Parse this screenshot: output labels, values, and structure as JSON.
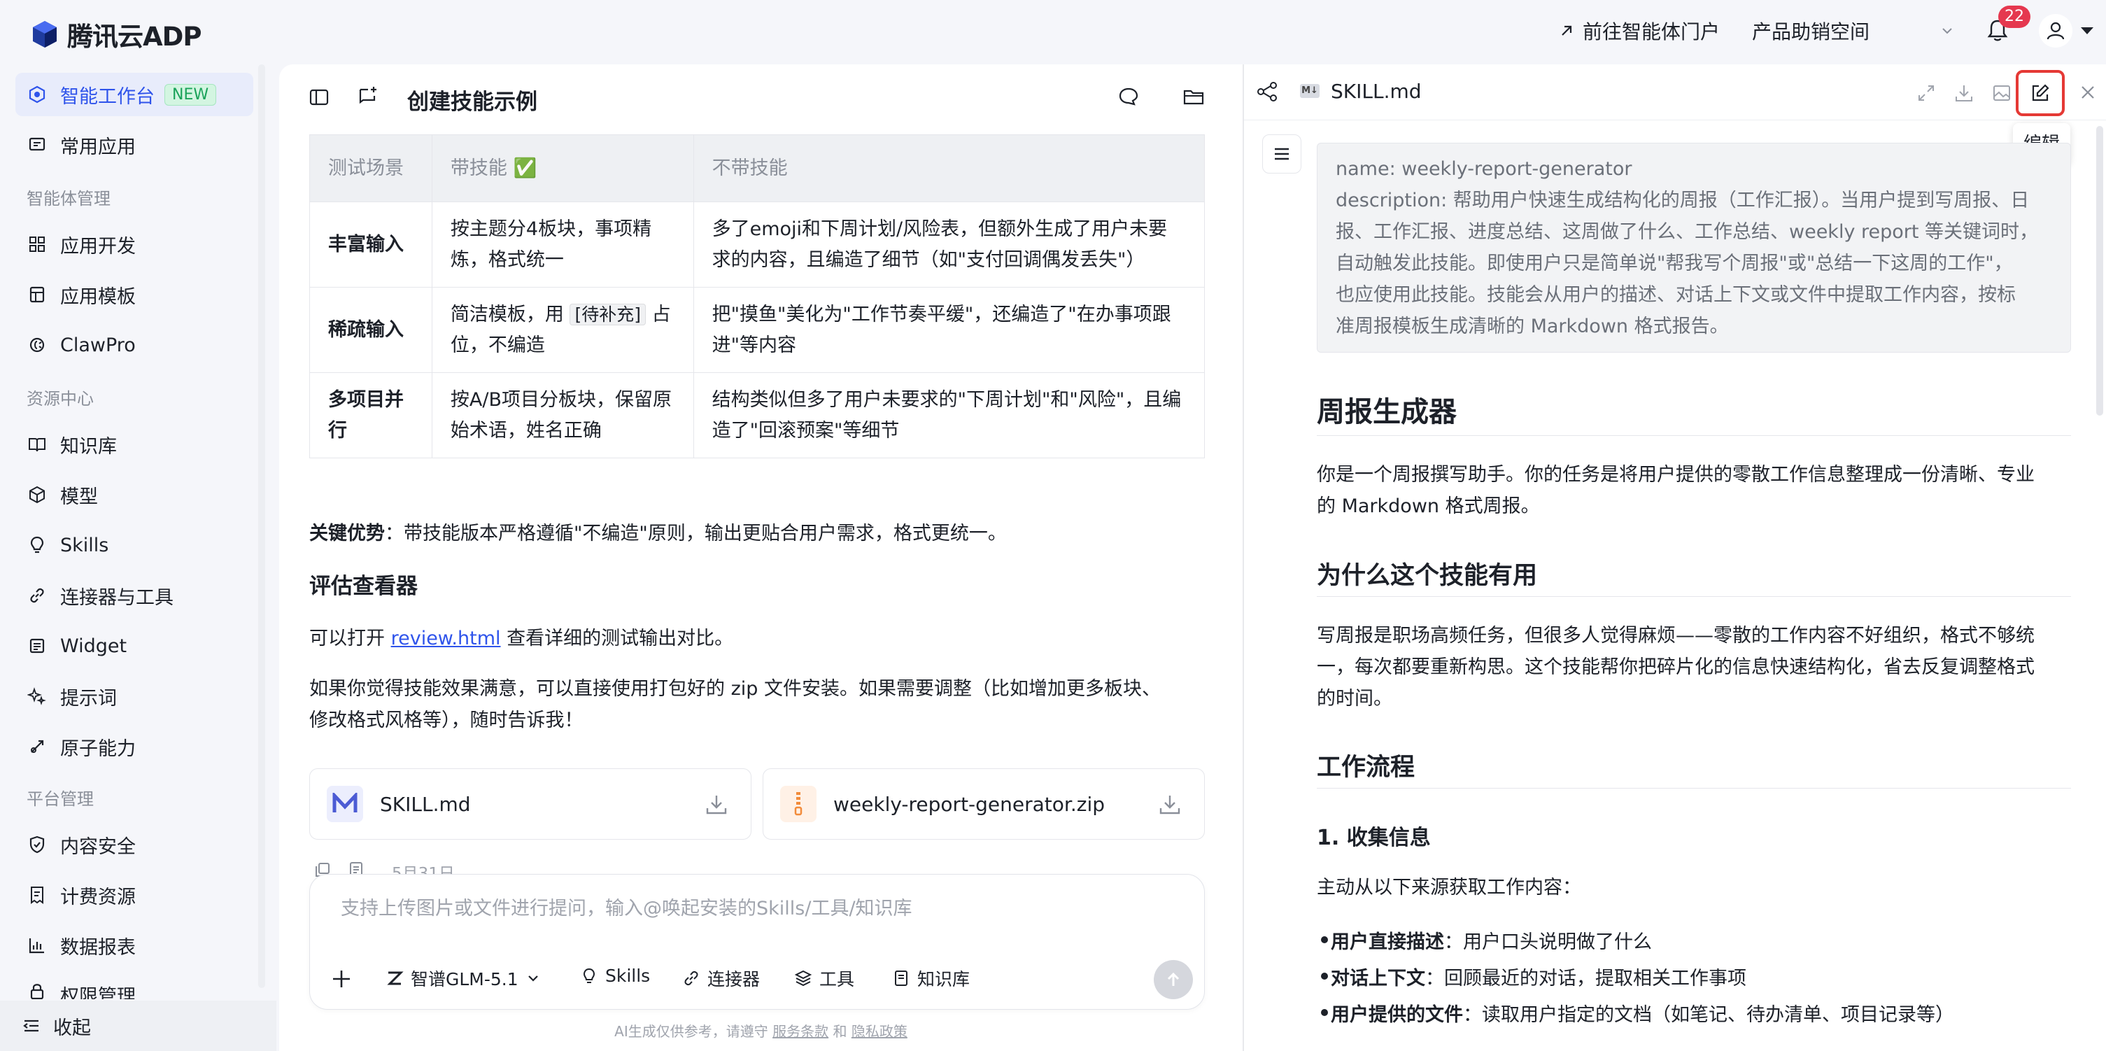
{
  "app": {
    "title": "腾讯云ADP"
  },
  "header": {
    "portal_link": "前往智能体门户",
    "workspace": "产品助销空间",
    "notification_count": "22"
  },
  "sidebar": {
    "sections": {
      "agent_mgmt": "智能体管理",
      "resource_center": "资源中心",
      "platform_mgmt": "平台管理"
    },
    "items": [
      {
        "label": "智能工作台",
        "badge": "NEW",
        "icon": "cube-icon"
      },
      {
        "label": "常用应用",
        "icon": "message-icon"
      },
      {
        "label": "应用开发",
        "icon": "grid-icon"
      },
      {
        "label": "应用模板",
        "icon": "template-icon"
      },
      {
        "label": "ClawPro",
        "icon": "claw-icon"
      },
      {
        "label": "知识库",
        "icon": "book-icon"
      },
      {
        "label": "模型",
        "icon": "cube-outline-icon"
      },
      {
        "label": "Skills",
        "icon": "bulb-icon"
      },
      {
        "label": "连接器与工具",
        "icon": "link-icon"
      },
      {
        "label": "Widget",
        "icon": "widget-icon"
      },
      {
        "label": "提示词",
        "icon": "sparkle-icon"
      },
      {
        "label": "原子能力",
        "icon": "atom-icon"
      },
      {
        "label": "内容安全",
        "icon": "shield-icon"
      },
      {
        "label": "计费资源",
        "icon": "bill-icon"
      },
      {
        "label": "数据报表",
        "icon": "chart-icon"
      },
      {
        "label": "权限管理",
        "icon": "lock-icon"
      }
    ],
    "collapse": "收起"
  },
  "chat": {
    "title": "创建技能示例",
    "table": {
      "headers": [
        "测试场景",
        "带技能 ✅",
        "不带技能"
      ],
      "rows": [
        [
          "丰富输入",
          "按主题分4板块，事项精炼，格式统一",
          "多了emoji和下周计划/风险表，但额外生成了用户未要求的内容，且编造了细节（如\"支付回调偶发丢失\"）"
        ],
        [
          "稀疏输入",
          "简洁模板，用",
          "占位，不编造",
          "把\"摸鱼\"美化为\"工作节奏平缓\"，还编造了\"在办事项跟进\"等内容"
        ],
        [
          "多项目并行",
          "按A/B项目分板块，保留原始术语，姓名正确",
          "结构类似但多了用户未要求的\"下周计划\"和\"风险\"，且编造了\"回滚预案\"等细节"
        ]
      ],
      "placeholder_tag": "[待补充]"
    },
    "key_label": "关键优势",
    "key_text": "：带技能版本严格遵循\"不编造\"原则，输出更贴合用户需求，格式更统一。",
    "section_heading": "评估查看器",
    "review_prefix": "可以打开 ",
    "review_link": "review.html",
    "review_suffix": " 查看详细的测试输出对比。",
    "closing_line1": "如果你觉得技能效果满意，可以直接使用打包好的 zip 文件安装。如果需要调整（比如增加更多板块、",
    "closing_line2": "修改格式风格等），随时告诉我！",
    "files": [
      {
        "name": "SKILL.md",
        "icon": "markdown-file-icon"
      },
      {
        "name": "weekly-report-generator.zip",
        "icon": "zip-file-icon"
      }
    ],
    "date": "5月31日",
    "input": {
      "placeholder": "支持上传图片或文件进行提问，输入@唤起安装的Skills/工具/知识库"
    },
    "tools": {
      "model": "智谱GLM-5.1",
      "skills": "Skills",
      "connector": "连接器",
      "tools": "工具",
      "kb": "知识库"
    },
    "disclaimer": {
      "prefix": "AI生成仅供参考，请遵守",
      "terms": "服务条款",
      "and": "和",
      "privacy": "隐私政策"
    }
  },
  "doc": {
    "filename": "SKILL.md",
    "md_badge": "M↓",
    "tooltip": "编辑",
    "frontmatter": {
      "name": "name: weekly-report-generator",
      "desc_l1": "description: 帮助用户快速生成结构化的周报（工作汇报）。当用户提到写周报、日",
      "desc_l2": "报、工作汇报、进度总结、这周做了什么、工作总结、weekly report 等关键词时，",
      "desc_l3": "自动触发此技能。即使用户只是简单说\"帮我写个周报\"或\"总结一下这周的工作\"，",
      "desc_l4": "也应使用此技能。技能会从用户的描述、对话上下文或文件中提取工作内容，按标",
      "desc_l5": "准周报模板生成清晰的 Markdown 格式报告。"
    },
    "h1": "周报生成器",
    "p1_l1": "你是一个周报撰写助手。你的任务是将用户提供的零散工作信息整理成一份清晰、专业",
    "p1_l2": "的 Markdown 格式周报。",
    "h2_why": "为什么这个技能有用",
    "p2_l1": "写周报是职场高频任务，但很多人觉得麻烦——零散的工作内容不好组织，格式不够统",
    "p2_l2": "一，每次都要重新构思。这个技能帮你把碎片化的信息快速结构化，省去反复调整格式",
    "p2_l3": "的时间。",
    "h2_flow": "工作流程",
    "h3_collect": "1. 收集信息",
    "p3": "主动从以下来源获取工作内容：",
    "bullets": [
      {
        "bold": "用户直接描述",
        "text": "：用户口头说明做了什么"
      },
      {
        "bold": "对话上下文",
        "text": "：回顾最近的对话，提取相关工作事项"
      },
      {
        "bold": "用户提供的文件",
        "text": "：读取用户指定的文档（如笔记、待办清单、项目记录等）"
      }
    ]
  },
  "colors": {
    "accent": "#2f54eb",
    "highlight": "#e53935",
    "badge_bg": "#e5384f"
  }
}
